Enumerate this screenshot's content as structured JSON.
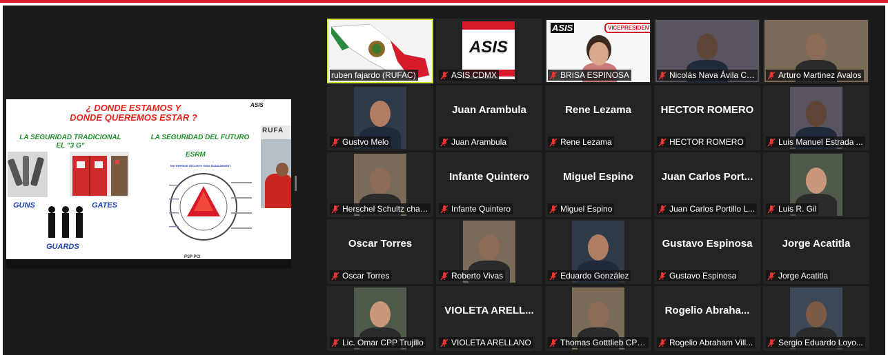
{
  "shared_slide": {
    "title_line1": "¿ DONDE ESTAMOS Y",
    "title_line2": "DONDE QUEREMOS ESTAR ?",
    "logo": "ASIS",
    "left_heading_line1": "LA SEGURIDAD TRADICIONAL",
    "left_heading_line2": "EL \"3 G\"",
    "right_heading": "LA SEGURIDAD DEL FUTURO",
    "esrm": "ESRM",
    "esrm_subtitle": "ENTERPRISE SECURITY RISK MANAGEMENT",
    "guns": "GUNS",
    "gates": "GATES",
    "guards": "GUARDS",
    "footer_cert": "PSP   PCI",
    "presenter_wall_text": "RUFA"
  },
  "participants": [
    {
      "display": "ruben fajardo (RUFAC)",
      "center_text": "",
      "video": "mexico-flag-map",
      "active": true
    },
    {
      "display": "ASIS CDMX",
      "center_text": "",
      "video": "asis-logo",
      "active": false
    },
    {
      "display": "BRISA ESPINOSA",
      "center_text": "",
      "video": "person-vicepresidenta",
      "active": false,
      "overlay_logo": "ASIS",
      "overlay_badge": "VICEPRESIDENTA"
    },
    {
      "display": "Nicolás Nava Ávila CPP",
      "center_text": "",
      "video": "person",
      "active": false
    },
    {
      "display": "Arturo Martinez Avalos",
      "center_text": "",
      "video": "person",
      "active": false
    },
    {
      "display": "Gustvo Melo",
      "center_text": "",
      "video": "person",
      "active": false
    },
    {
      "display": "Juan Arambula",
      "center_text": "Juan Arambula",
      "video": "",
      "active": false
    },
    {
      "display": "Rene Lezama",
      "center_text": "Rene Lezama",
      "video": "",
      "active": false
    },
    {
      "display": "HECTOR ROMERO",
      "center_text": "HECTOR ROMERO",
      "video": "",
      "active": false
    },
    {
      "display": "Luis Manuel Estrada ...",
      "center_text": "",
      "video": "person",
      "active": false
    },
    {
      "display": "Herschel Schultz chav...",
      "center_text": "",
      "video": "person",
      "active": false
    },
    {
      "display": "Infante Quintero",
      "center_text": "Infante Quintero",
      "video": "",
      "active": false
    },
    {
      "display": "Miguel Espino",
      "center_text": "Miguel Espino",
      "video": "",
      "active": false
    },
    {
      "display": "Juan Carlos Portillo L...",
      "center_text": "Juan Carlos Port...",
      "video": "",
      "active": false
    },
    {
      "display": "Luis R. Gil",
      "center_text": "",
      "video": "person",
      "active": false
    },
    {
      "display": "Oscar Torres",
      "center_text": "Oscar Torres",
      "video": "",
      "active": false
    },
    {
      "display": "Roberto Vivas",
      "center_text": "",
      "video": "person",
      "active": false
    },
    {
      "display": "Eduardo González",
      "center_text": "",
      "video": "person",
      "active": false
    },
    {
      "display": "Gustavo Espinosa",
      "center_text": "Gustavo Espinosa",
      "video": "",
      "active": false
    },
    {
      "display": "Jorge Acatitla",
      "center_text": "Jorge Acatitla",
      "video": "",
      "active": false
    },
    {
      "display": "Lic. Omar CPP Trujillo",
      "center_text": "",
      "video": "person",
      "active": false
    },
    {
      "display": "VIOLETA ARELLANO",
      "center_text": "VIOLETA ARELL...",
      "video": "",
      "active": false
    },
    {
      "display": "Thomas Gotttlieb CPP...",
      "center_text": "",
      "video": "person",
      "active": false
    },
    {
      "display": "Rogelio Abraham Vill...",
      "center_text": "Rogelio Abraha...",
      "video": "",
      "active": false
    },
    {
      "display": "Sergio Eduardo Loyo...",
      "center_text": "",
      "video": "person",
      "active": false
    }
  ],
  "colors": {
    "accent_red": "#d71b2b",
    "active_speaker_border": "#d4e33a",
    "tile_bg": "#242424",
    "stage_bg": "#1a1a1a"
  },
  "icons": {
    "muted": "muted-microphone-icon"
  }
}
